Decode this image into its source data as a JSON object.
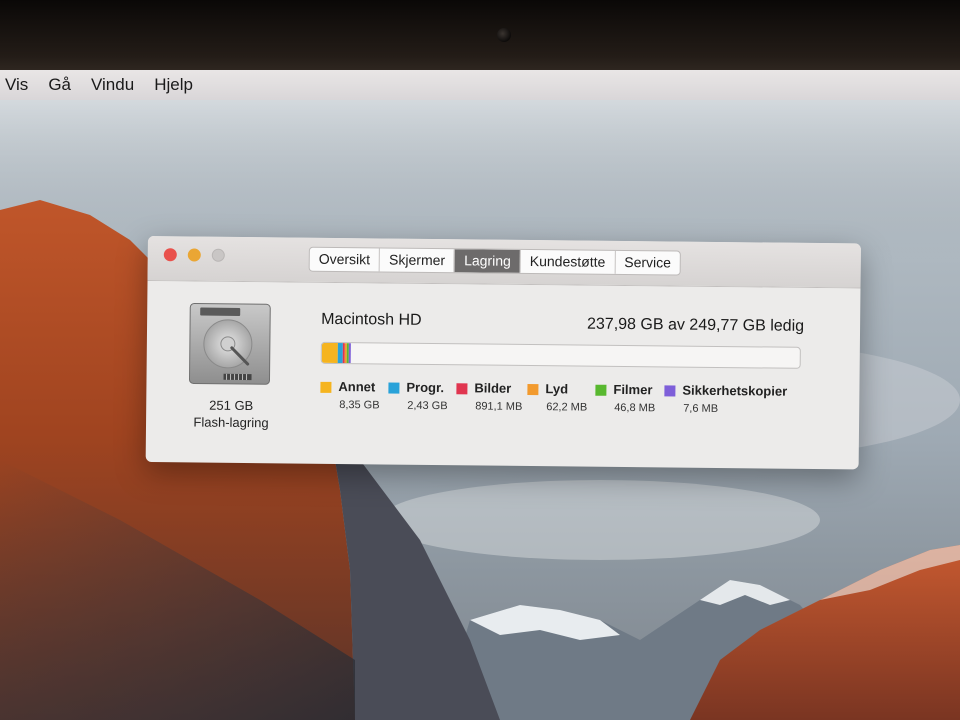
{
  "menubar": {
    "items": [
      "Vis",
      "Gå",
      "Vindu",
      "Hjelp"
    ]
  },
  "window": {
    "tabs": [
      {
        "label": "Oversikt",
        "active": false
      },
      {
        "label": "Skjermer",
        "active": false
      },
      {
        "label": "Lagring",
        "active": true
      },
      {
        "label": "Kundestøtte",
        "active": false
      },
      {
        "label": "Service",
        "active": false
      }
    ],
    "storage": {
      "disk_icon": "hard-drive-icon",
      "capacity": "251 GB",
      "type": "Flash-lagring",
      "volume_name": "Macintosh HD",
      "free_text": "237,98 GB av 249,77 GB ledig",
      "used_fraction": 0.047,
      "categories": [
        {
          "name": "Annet",
          "size": "8,35 GB",
          "color": "#f5b41f",
          "fraction": 0.0334
        },
        {
          "name": "Progr.",
          "size": "2,43 GB",
          "color": "#29a2d9",
          "fraction": 0.0097
        },
        {
          "name": "Bilder",
          "size": "891,1 MB",
          "color": "#e0354f",
          "fraction": 0.0036
        },
        {
          "name": "Lyd",
          "size": "62,2 MB",
          "color": "#f29a2e",
          "fraction": 0.0025
        },
        {
          "name": "Filmer",
          "size": "46,8 MB",
          "color": "#58b82f",
          "fraction": 0.002
        },
        {
          "name": "Sikkerhetskopier",
          "size": "7,6 MB",
          "color": "#7e5fd9",
          "fraction": 0.001
        }
      ]
    }
  }
}
